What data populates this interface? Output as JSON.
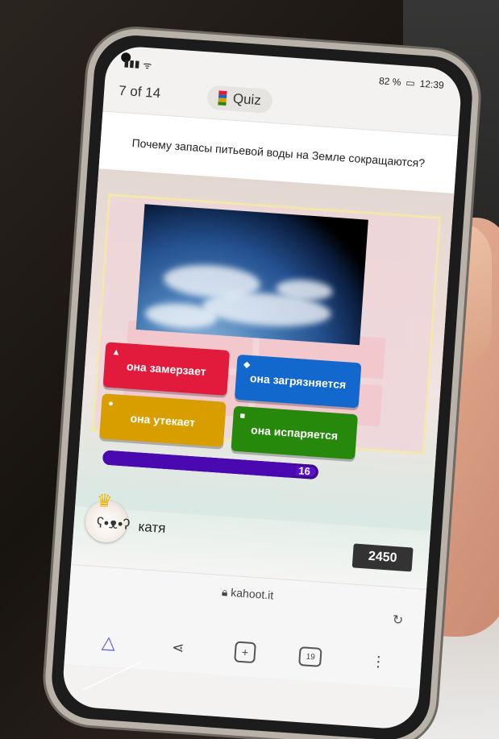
{
  "status": {
    "network": "ᯤ",
    "battery": "82 %",
    "time": "12:39"
  },
  "header": {
    "counter": "7 of 14",
    "quiz_label": "Quiz"
  },
  "question": {
    "text": "Почему запасы питьевой воды на Земле сокращаются?"
  },
  "answers": [
    {
      "shape": "▲",
      "label": "она замерзает",
      "color": "#e21b3c"
    },
    {
      "shape": "◆",
      "label": "она загрязняется",
      "color": "#1368ce"
    },
    {
      "shape": "●",
      "label": "она утекает",
      "color": "#d89e00"
    },
    {
      "shape": "■",
      "label": "она испаряется",
      "color": "#26890c"
    }
  ],
  "timer": {
    "value": "16",
    "fraction": 0.9
  },
  "player": {
    "name": "катя",
    "score": "2450"
  },
  "browser": {
    "url": "kahoot.it",
    "lock_icon": "lock-icon",
    "reload_icon": "reload-icon"
  },
  "nav": {
    "tabs_count": "19",
    "items": [
      "home-icon",
      "share-icon",
      "new-tab-icon",
      "tabs-icon",
      "more-icon"
    ]
  }
}
